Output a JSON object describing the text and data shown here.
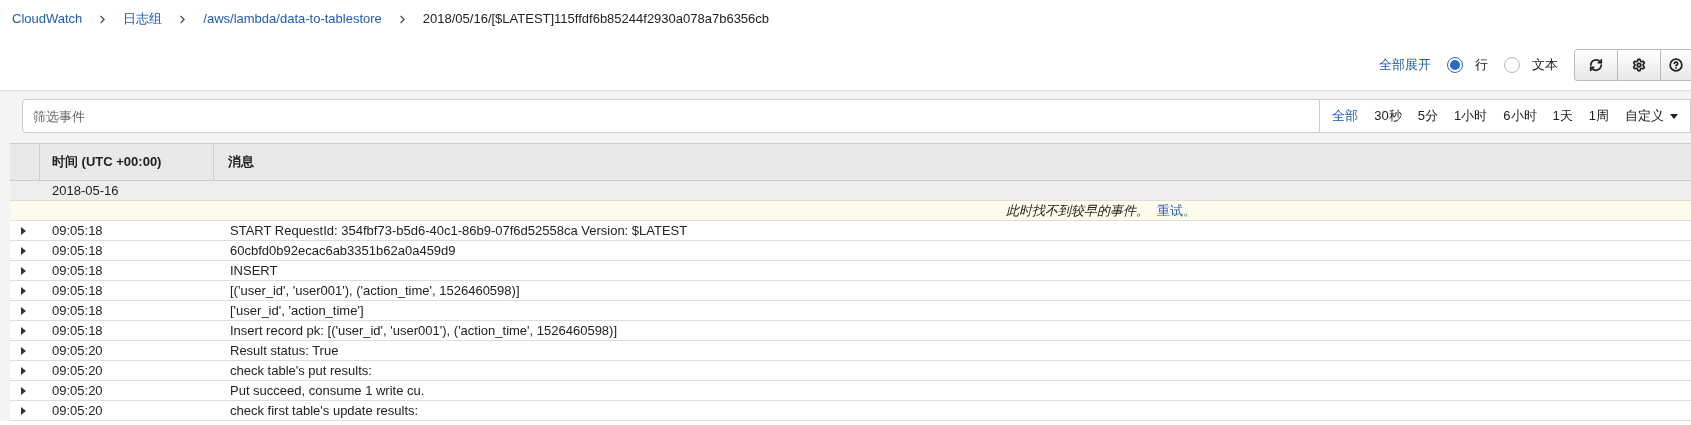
{
  "breadcrumb": [
    {
      "label": "CloudWatch",
      "link": true
    },
    {
      "label": "日志组",
      "link": true
    },
    {
      "label": "/aws/lambda/data-to-tablestore",
      "link": true
    },
    {
      "label": "2018/05/16/[$LATEST]115ffdf6b85244f2930a078a7b6356cb",
      "link": false
    }
  ],
  "expand_all": "全部展开",
  "view_modes": [
    {
      "label": "行",
      "selected": true
    },
    {
      "label": "文本",
      "selected": false
    }
  ],
  "filter": {
    "placeholder": "筛选事件"
  },
  "time_ranges": [
    {
      "label": "全部",
      "selected": true
    },
    {
      "label": "30秒",
      "selected": false
    },
    {
      "label": "5分",
      "selected": false
    },
    {
      "label": "1小时",
      "selected": false
    },
    {
      "label": "6小时",
      "selected": false
    },
    {
      "label": "1天",
      "selected": false
    },
    {
      "label": "1周",
      "selected": false
    }
  ],
  "custom_range": "自定义",
  "table": {
    "columns": [
      "时间 (UTC +00:00)",
      "消息"
    ],
    "date": "2018-05-16",
    "notice": {
      "text": "此时找不到较早的事件。",
      "link": "重试。"
    },
    "rows": [
      {
        "time": "09:05:18",
        "message": "START RequestId: 354fbf73-b5d6-40c1-86b9-07f6d52558ca Version: $LATEST"
      },
      {
        "time": "09:05:18",
        "message": "60cbfd0b92ecac6ab3351b62a0a459d9"
      },
      {
        "time": "09:05:18",
        "message": "INSERT"
      },
      {
        "time": "09:05:18",
        "message": "[('user_id', 'user001'), ('action_time', 1526460598)]"
      },
      {
        "time": "09:05:18",
        "message": "['user_id', 'action_time']"
      },
      {
        "time": "09:05:18",
        "message": "Insert record pk: [('user_id', 'user001'), ('action_time', 1526460598)]"
      },
      {
        "time": "09:05:20",
        "message": "Result status: True"
      },
      {
        "time": "09:05:20",
        "message": "check table's put results:"
      },
      {
        "time": "09:05:20",
        "message": "Put succeed, consume 1 write cu."
      },
      {
        "time": "09:05:20",
        "message": "check first table's update results:"
      }
    ]
  }
}
